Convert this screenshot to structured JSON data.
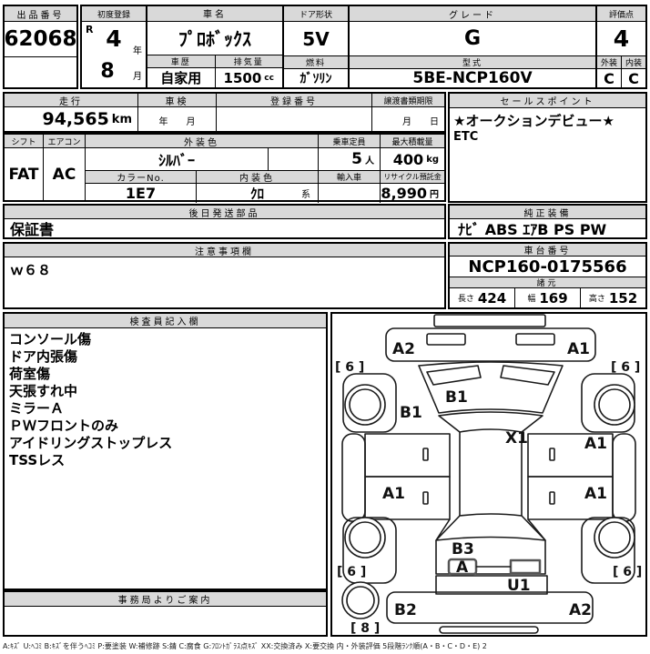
{
  "top": {
    "lot": {
      "label": "出品番号",
      "value": "62068"
    },
    "first_reg": {
      "label": "初度登録",
      "era": "R",
      "year": "4",
      "year_unit": "年",
      "month": "8",
      "month_unit": "月"
    },
    "name": {
      "label": "車名",
      "value": "ﾌﾟﾛﾎﾞｯｸｽ"
    },
    "history": {
      "label": "車歴",
      "value": "自家用"
    },
    "displacement": {
      "label": "排気量",
      "value": "1500",
      "unit": "cc"
    },
    "door": {
      "label": "ドア形状",
      "value": "5V"
    },
    "fuel": {
      "label": "燃料",
      "value": "ｶﾞｿﾘﾝ"
    },
    "grade": {
      "label": "グレード",
      "value": "G"
    },
    "model": {
      "label": "型式",
      "value": "5BE-NCP160V"
    },
    "score": {
      "label": "評価点",
      "value": "4",
      "exterior_label": "外装",
      "exterior": "C",
      "interior_label": "内装",
      "interior": "C"
    }
  },
  "mileage_row": {
    "mileage": {
      "label": "走行",
      "value": "94,565",
      "unit": "km"
    },
    "inspection": {
      "label": "車検",
      "units": "年　　月"
    },
    "reg_no": {
      "label": "登録番号",
      "value": ""
    },
    "transfer": {
      "label": "譲渡書類期限",
      "units": "月　　日"
    }
  },
  "spec": {
    "shift": {
      "label": "シフト",
      "value": "FAT"
    },
    "aircon": {
      "label": "エアコン",
      "value": "AC"
    },
    "ext_color": {
      "label": "外装色",
      "value": "ｼﾙﾊﾞｰ"
    },
    "capacity": {
      "label": "乗車定員",
      "value": "5",
      "unit": "人"
    },
    "max_load": {
      "label": "最大積載量",
      "value": "400",
      "unit": "kg"
    },
    "color_no": {
      "label": "カラーNo.",
      "value": "1E7"
    },
    "int_color": {
      "label": "内装色",
      "value": "ｸﾛ",
      "suffix": "系"
    },
    "imported": {
      "label": "輸入車",
      "value": ""
    },
    "recycle": {
      "label": "リサイクル預託金",
      "value": "8,990",
      "unit": "円"
    }
  },
  "sales_point": {
    "label": "セールスポイント",
    "lines": [
      "★オークションデビュー★",
      "ETC"
    ]
  },
  "later_parts": {
    "label": "後日発送部品",
    "value": "保証書"
  },
  "oem": {
    "label": "純正装備",
    "value": "ﾅﾋﾞ ABS ｴｱB PS PW"
  },
  "notes": {
    "label": "注意事項欄",
    "value": "ｗ６８"
  },
  "chassis": {
    "label": "車台番号",
    "value": "NCP160-0175566"
  },
  "dimensions": {
    "label": "諸元",
    "length_label": "長さ",
    "length": "424",
    "width_label": "幅",
    "width": "169",
    "height_label": "高さ",
    "height": "152"
  },
  "inspector": {
    "label": "検査員記入欄",
    "lines": [
      "コンソール傷",
      "ドア内張傷",
      "荷室傷",
      "天張すれ中",
      "ミラーＡ",
      "ＰＷフロントのみ",
      "アイドリングストップレス",
      "TSSレス"
    ]
  },
  "office": {
    "label": "事務局よりご案内"
  },
  "diagram": {
    "marks": {
      "front_bumper_left": "A2",
      "front_bumper_right": "A1",
      "hood": "B1",
      "left_front_fender": "B1",
      "windshield": "X1",
      "right_front_door": "A1",
      "left_rear_door": "A1",
      "right_rear_door": "A1",
      "tailgate": "B3",
      "rear_gate": "A",
      "rear_under": "U1",
      "rear_bumper_left": "B2",
      "rear_bumper_right": "A2",
      "tire_front_left": "[ 6 ]",
      "tire_front_right": "[ 6 ]",
      "tire_rear_left": "[ 6 ]",
      "tire_rear_right": "[ 6 ]",
      "spare_tire": "[ 8 ]"
    }
  },
  "footer": {
    "legend": "A:ｷｽﾞ U:ﾍｺﾐ B:ｷｽﾞを伴うﾍｺﾐ P:要塗装 W:補修跡 S:錆 C:腐食 G:ﾌﾛﾝﾄｶﾞﾗｽ点ｷｽﾞ XX:交換済み X:要交換 内・外装評価 5段階ﾗﾝｸ順(A・B・C・D・E) 2"
  }
}
